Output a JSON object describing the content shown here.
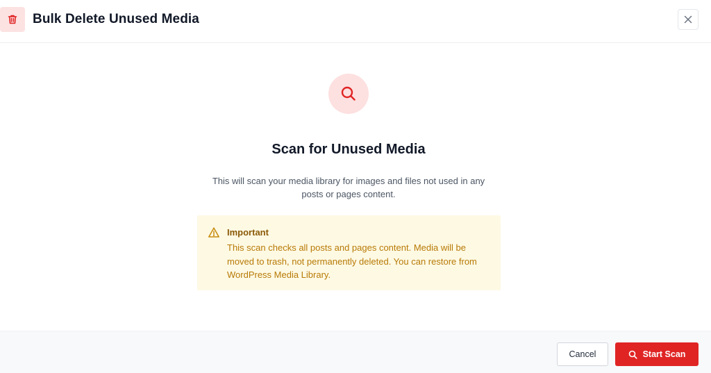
{
  "header": {
    "title": "Bulk Delete Unused Media",
    "icon": "trash-icon",
    "close_icon": "close-icon"
  },
  "main": {
    "icon": "search-icon",
    "title": "Scan for Unused Media",
    "description": "This will scan your media library for images and files not used in any posts or pages content."
  },
  "notice": {
    "icon": "warning-icon",
    "title": "Important",
    "text": "This scan checks all posts and pages content. Media will be moved to trash, not permanently deleted. You can restore from WordPress Media Library."
  },
  "footer": {
    "cancel_label": "Cancel",
    "start_label": "Start Scan",
    "start_icon": "search-icon"
  },
  "colors": {
    "accent": "#e02424",
    "accent_soft": "#fde0e0",
    "notice_bg": "#fef9e3",
    "notice_text": "#b77a06"
  }
}
